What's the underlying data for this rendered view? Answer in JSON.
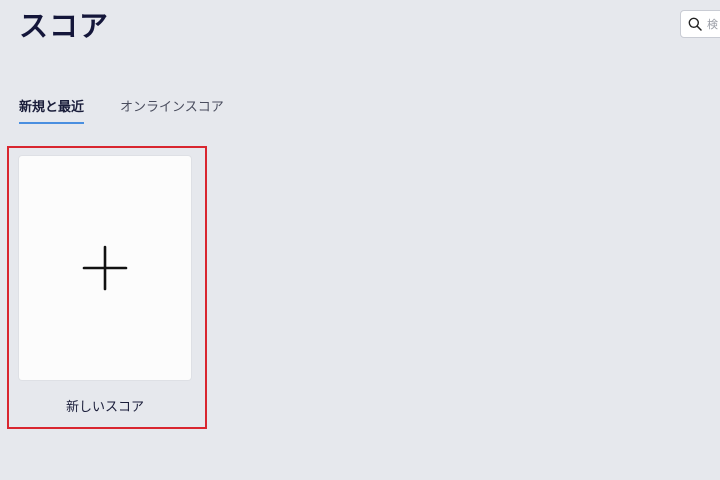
{
  "page": {
    "title": "スコア"
  },
  "search": {
    "placeholder": "検"
  },
  "tabs": [
    {
      "label": "新規と最近",
      "active": true
    },
    {
      "label": "オンラインスコア",
      "active": false
    }
  ],
  "cards": [
    {
      "label": "新しいスコア",
      "icon": "plus-icon"
    }
  ],
  "colors": {
    "background": "#e6e8ed",
    "active_tab_underline": "#4a8fe0",
    "highlight_frame": "#d9262f",
    "card_background": "#fcfcfc"
  }
}
